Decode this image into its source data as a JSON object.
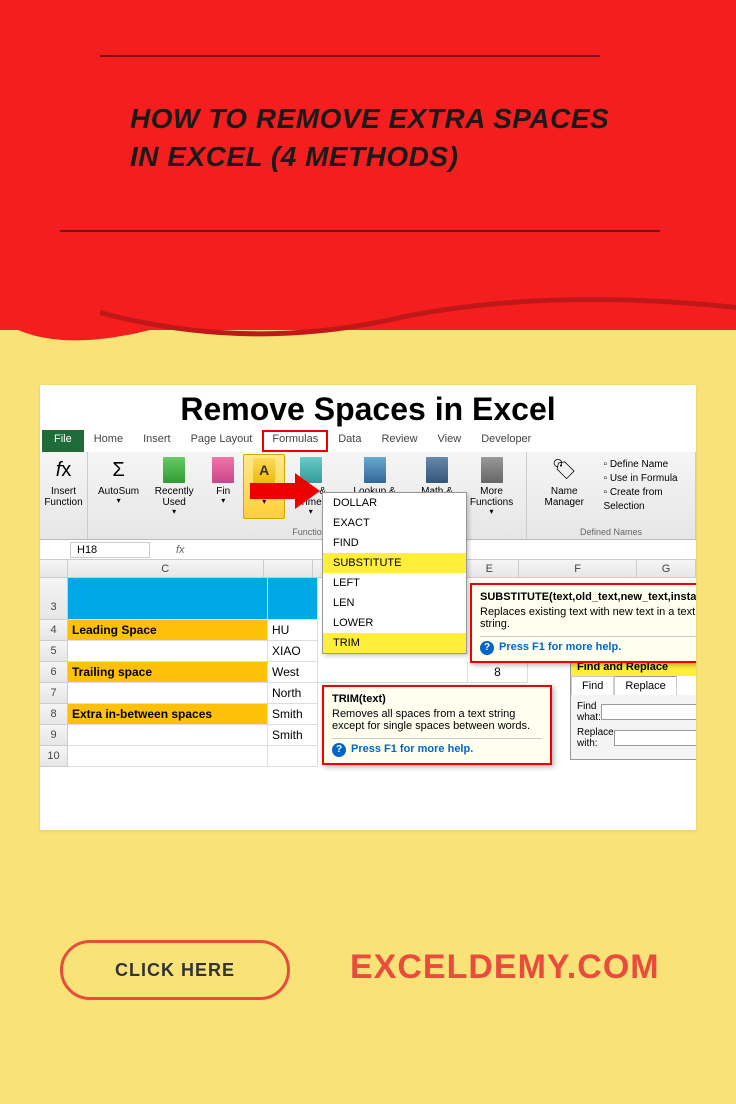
{
  "header": {
    "title": "HOW TO REMOVE EXTRA SPACES IN EXCEL (4 METHODS)"
  },
  "excel": {
    "page_title": "Remove Spaces in Excel",
    "tabs": {
      "file": "File",
      "home": "Home",
      "insert": "Insert",
      "page_layout": "Page Layout",
      "formulas": "Formulas",
      "data": "Data",
      "review": "Review",
      "view": "View",
      "developer": "Developer"
    },
    "ribbon": {
      "insert_function": "Insert Function",
      "autosum": "AutoSum",
      "recently_used": "Recently Used",
      "financial": "Fin",
      "text": "Text",
      "date_time": "Date & Time",
      "lookup": "Lookup & Reference",
      "math": "Math & Trig",
      "more": "More Functions",
      "name_manager": "Name Manager",
      "group_func": "Functio",
      "group_names": "Defined Names",
      "define_name": "Define Name",
      "use_formula": "Use in Formula",
      "create_selection": "Create from Selection"
    },
    "dropdown": {
      "items": [
        "DOLLAR",
        "EXACT",
        "FIND",
        "SUBSTITUTE",
        "LEFT",
        "LEN",
        "LOWER",
        "TRIM"
      ]
    },
    "namebox": "H18",
    "fx": "fx",
    "columns": [
      "C",
      "",
      "E",
      "F",
      "G"
    ],
    "rows": {
      "r3": {
        "c": ""
      },
      "r4": {
        "c": "Leading Space",
        "d": "HU"
      },
      "r5": {
        "c": "",
        "d": "XIAO"
      },
      "r6": {
        "c": "Trailing space",
        "d": "West",
        "e": "8"
      },
      "r7": {
        "c": "",
        "d": "North"
      },
      "r8": {
        "c": "Extra in-between spaces",
        "d": "Smith"
      },
      "r9": {
        "c": "",
        "d": "Smith"
      },
      "r10": {
        "c": ""
      }
    },
    "tooltip_sub": {
      "title": "SUBSTITUTE(text,old_text,new_text,instance_num)",
      "body": "Replaces existing text with new text in a text string.",
      "help": "Press F1 for more help."
    },
    "tooltip_trim": {
      "title": "TRIM(text)",
      "body": "Removes all spaces from a text string except for single spaces between words.",
      "help": "Press F1 for more help."
    },
    "find_replace": {
      "title": "Find and Replace",
      "tab_find": "Find",
      "tab_replace": "Replace",
      "find_what": "Find what:",
      "replace_with": "Replace with:"
    }
  },
  "cta": {
    "button": "CLICK HERE",
    "site": "EXCELDEMY.COM"
  }
}
